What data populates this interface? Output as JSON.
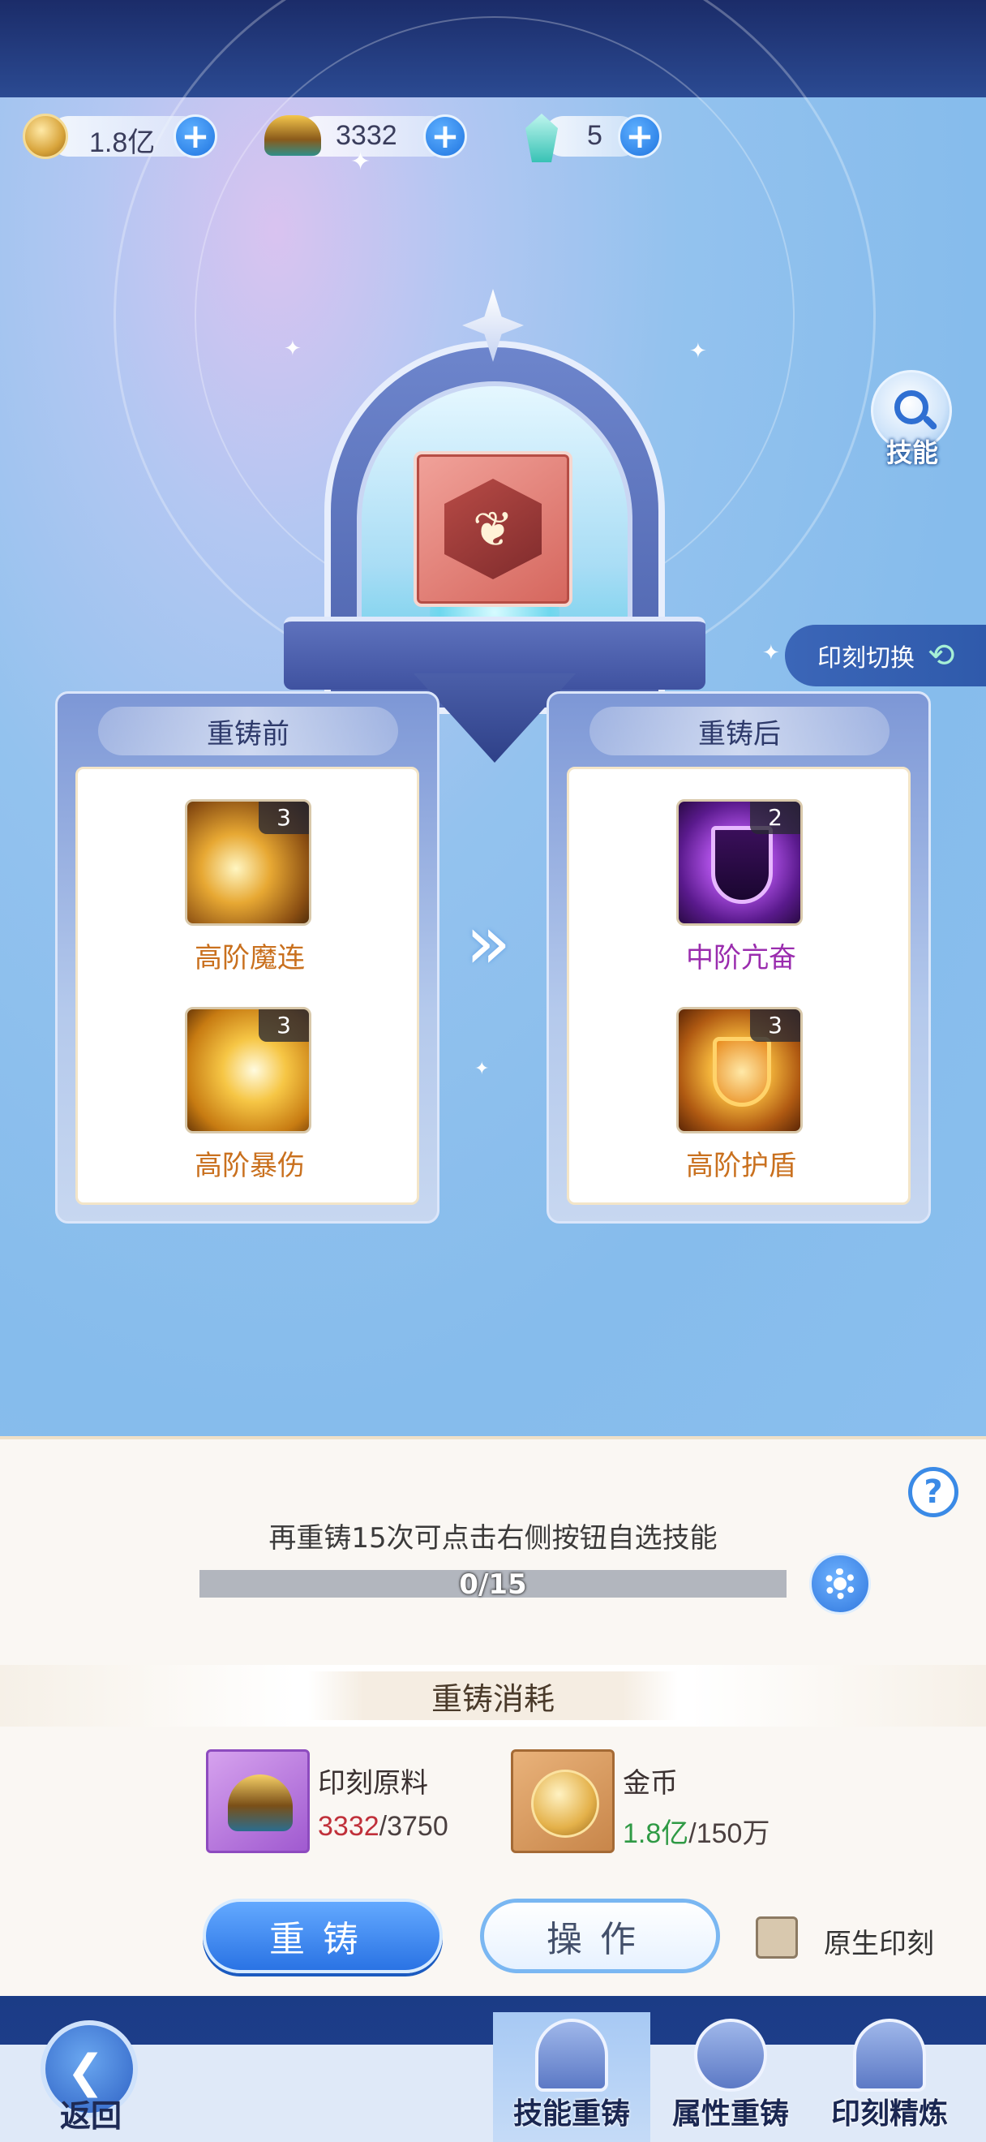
{
  "currency": {
    "gold": {
      "value": "1.8亿",
      "icon": "gold-coin-icon"
    },
    "material": {
      "value": "3332",
      "icon": "imprint-material-icon"
    },
    "crystal": {
      "value": "5",
      "icon": "crystal-icon"
    },
    "plus": "+"
  },
  "skill_button": {
    "label": "技能"
  },
  "imprint_switch": {
    "label": "印刻切换"
  },
  "before": {
    "title": "重铸前",
    "skills": [
      {
        "name": "高阶魔连",
        "level": "3",
        "color": "#c9701e"
      },
      {
        "name": "高阶暴伤",
        "level": "3",
        "color": "#c9701e"
      }
    ]
  },
  "after": {
    "title": "重铸后",
    "skills": [
      {
        "name": "中阶亢奋",
        "level": "2",
        "color": "#9a2cae"
      },
      {
        "name": "高阶护盾",
        "level": "3",
        "color": "#c9701e"
      }
    ]
  },
  "arrow": "»",
  "help": "?",
  "hint": "再重铸15次可点击右侧按钮自选技能",
  "progress": {
    "text": "0/15",
    "current": 0,
    "total": 15
  },
  "cost": {
    "title": "重铸消耗",
    "items": [
      {
        "name": "印刻原料",
        "have": "3332",
        "need": "/3750",
        "have_color": "#c0303a"
      },
      {
        "name": "金币",
        "have": "1.8亿",
        "need": "/150万",
        "have_color": "#2f9a45"
      }
    ]
  },
  "buttons": {
    "reforge": "重铸",
    "operate": "操作"
  },
  "checkbox": {
    "label": "原生印刻",
    "checked": false
  },
  "nav": {
    "back": "返回",
    "tabs": [
      {
        "label": "技能重铸",
        "active": true
      },
      {
        "label": "属性重铸",
        "active": false
      },
      {
        "label": "印刻精炼",
        "active": false
      }
    ]
  }
}
